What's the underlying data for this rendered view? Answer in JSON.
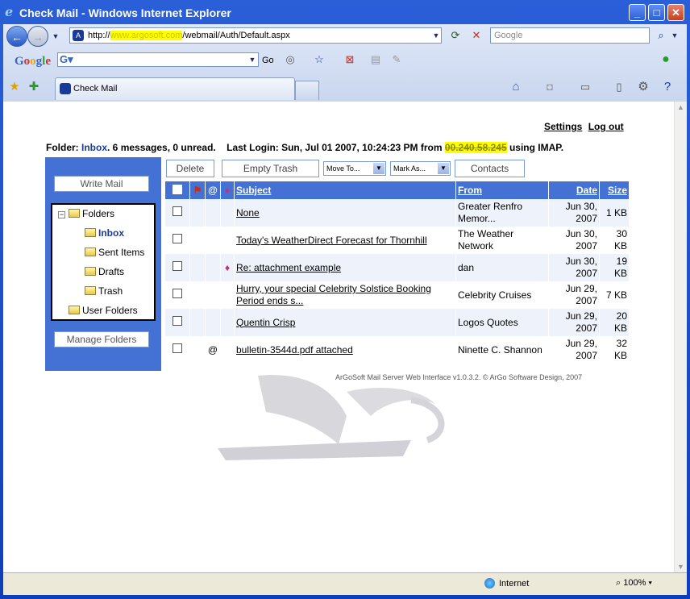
{
  "window": {
    "title": "Check Mail - Windows Internet Explorer",
    "url_prefix": "http://",
    "url_redacted": "www.argosoft.com",
    "url_suffix": "/webmail/Auth/Default.aspx",
    "search_placeholder": "Google",
    "tab_title": "Check Mail",
    "google_label": "Google",
    "go_label": "Go"
  },
  "header": {
    "settings": "Settings",
    "logout": "Log out"
  },
  "info": {
    "folder_label": "Folder:",
    "folder_name": "Inbox",
    "summary": ". 6 messages, 0 unread.",
    "last_login": "Last Login: Sun, Jul 01 2007, 10:24:23 PM from",
    "ip_redacted": "00.240.58.245",
    "protocol": "using IMAP."
  },
  "sidebar": {
    "write_mail": "Write Mail",
    "folders_root": "Folders",
    "folders": [
      "Inbox",
      "Sent Items",
      "Drafts",
      "Trash"
    ],
    "user_folders": "User Folders",
    "manage_folders": "Manage Folders"
  },
  "toolbar": {
    "delete": "Delete",
    "empty_trash": "Empty Trash",
    "move_to": "Move To...",
    "mark_as": "Mark As...",
    "contacts": "Contacts"
  },
  "columns": {
    "subject": "Subject",
    "from": "From",
    "date": "Date",
    "size": "Size"
  },
  "messages": [
    {
      "subject": "None",
      "from": "Greater Renfro Memor...",
      "date": "Jun 30, 2007",
      "size": "1 KB",
      "attachment": false,
      "flag": false
    },
    {
      "subject": "Today's WeatherDirect Forecast for Thornhill",
      "from": "The Weather Network",
      "date": "Jun 30, 2007",
      "size": "30 KB",
      "attachment": false,
      "flag": false
    },
    {
      "subject": "Re: attachment example",
      "from": "dan",
      "date": "Jun 30, 2007",
      "size": "19 KB",
      "attachment": false,
      "flag": true
    },
    {
      "subject": "Hurry, your special Celebrity Solstice Booking Period ends s...",
      "from": "Celebrity Cruises",
      "date": "Jun 29, 2007",
      "size": "7 KB",
      "attachment": false,
      "flag": false
    },
    {
      "subject": "Quentin Crisp",
      "from": "Logos Quotes",
      "date": "Jun 29, 2007",
      "size": "20 KB",
      "attachment": false,
      "flag": false
    },
    {
      "subject": "bulletin-3544d.pdf attached",
      "from": "Ninette C. Shannon",
      "date": "Jun 29, 2007",
      "size": "32 KB",
      "attachment": true,
      "flag": false
    }
  ],
  "footer": "ArGoSoft Mail Server Web Interface v1.0.3.2.   © ArGo Software Design, 2007",
  "status": {
    "zone": "Internet",
    "zoom": "100%"
  },
  "colors": {
    "accent": "#4472d4",
    "link": "#1a3a9a"
  }
}
